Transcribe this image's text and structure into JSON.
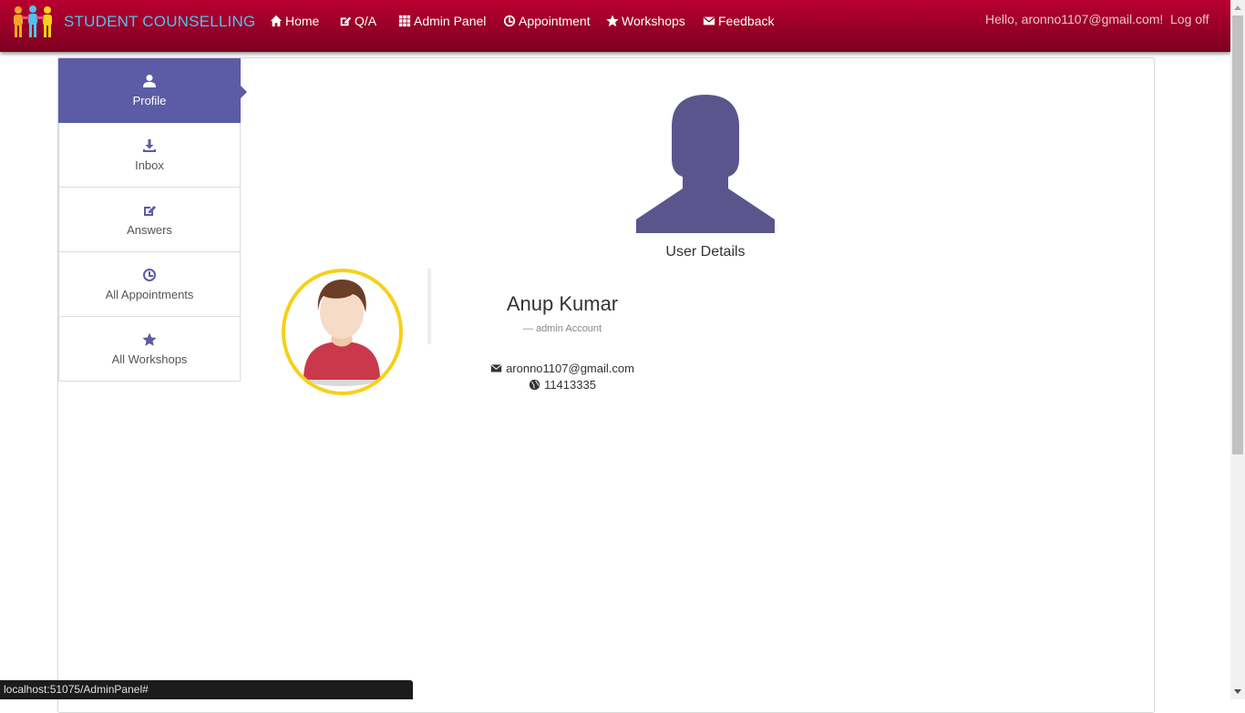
{
  "brand": {
    "title": "STUDENT COUNSELLING",
    "logo_icon": "people-logo-icon"
  },
  "nav": {
    "items": [
      {
        "label": "Home",
        "icon": "home-icon"
      },
      {
        "label": "Q/A",
        "icon": "edit-icon"
      },
      {
        "label": "Admin Panel",
        "icon": "grid-icon"
      },
      {
        "label": "Appointment",
        "icon": "clock-icon"
      },
      {
        "label": "Workshops",
        "icon": "star-icon"
      },
      {
        "label": "Feedback",
        "icon": "envelope-icon"
      }
    ],
    "greeting": "Hello, aronno1107@gmail.com!",
    "logout": "Log off"
  },
  "sidebar": {
    "items": [
      {
        "label": "Profile",
        "icon": "user-icon",
        "active": true
      },
      {
        "label": "Inbox",
        "icon": "download-icon",
        "active": false
      },
      {
        "label": "Answers",
        "icon": "edit-icon",
        "active": false
      },
      {
        "label": "All Appointments",
        "icon": "clock-icon",
        "active": false
      },
      {
        "label": "All Workshops",
        "icon": "star-icon",
        "active": false
      }
    ]
  },
  "profile": {
    "section_title": "User Details",
    "name": "Anup Kumar",
    "role": "— admin Account",
    "email": "aronno1107@gmail.com",
    "phone": "11413335"
  },
  "status_bar": {
    "url": "localhost:51075/AdminPanel#"
  },
  "colors": {
    "nav_top": "#b8002f",
    "nav_bottom": "#7c0021",
    "brand_text": "#4ec3ee",
    "accent": "#5c5ba5",
    "ring": "#f6d01a"
  }
}
